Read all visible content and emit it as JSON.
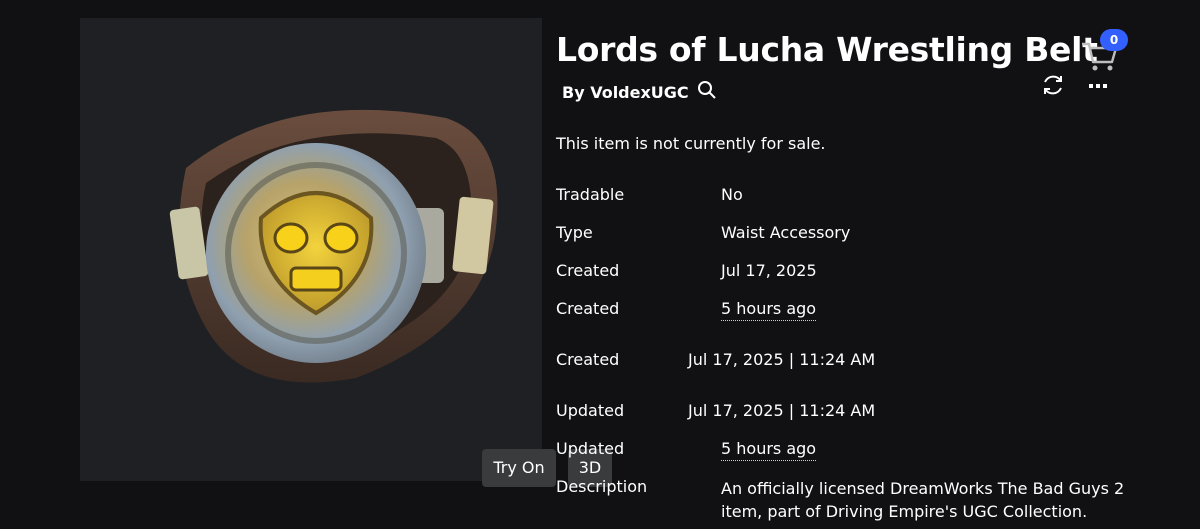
{
  "item": {
    "title": "Lords of Lucha Wrestling Belt",
    "by_label": "By VoldexUGC",
    "sale_status": "This item is not currently for sale."
  },
  "header": {
    "cart_count": "0"
  },
  "preview": {
    "try_on_label": "Try On",
    "view_3d_label": "3D"
  },
  "details": {
    "tradable": {
      "label": "Tradable",
      "value": "No"
    },
    "type": {
      "label": "Type",
      "value": "Waist Accessory"
    },
    "created_date": {
      "label": "Created",
      "value": "Jul 17, 2025"
    },
    "created_relative": {
      "label": "Created",
      "value": "5 hours ago"
    },
    "created_full": {
      "label": "Created",
      "value": "Jul 17, 2025 | 11:24 AM"
    },
    "updated_full": {
      "label": "Updated",
      "value": "Jul 17, 2025 | 11:24 AM"
    },
    "updated_relative": {
      "label": "Updated",
      "value": "5 hours ago"
    },
    "description": {
      "label": "Description",
      "value": "An officially licensed DreamWorks The Bad Guys 2 item, part of Driving Empire's UGC Collection."
    }
  },
  "icons": {
    "cart": "cart-icon",
    "search": "search-icon",
    "refresh": "refresh-icon",
    "more": "more-icon"
  },
  "colors": {
    "background": "#111113",
    "preview_bg": "#1f2024",
    "button_bg": "#393b3d",
    "badge_blue": "#335fff"
  }
}
